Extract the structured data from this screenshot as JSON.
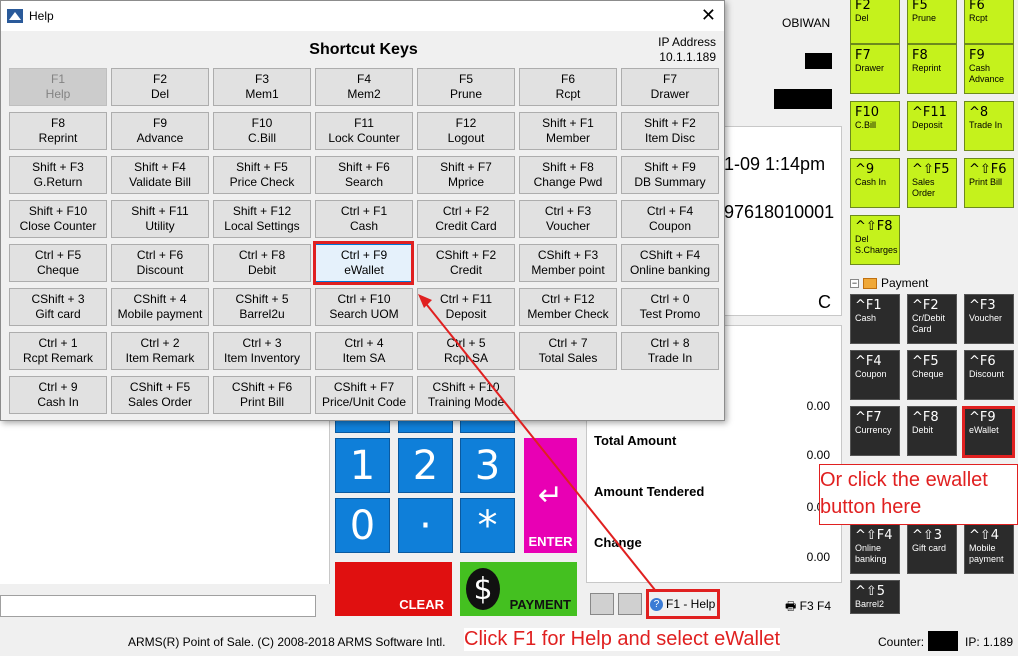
{
  "dialog": {
    "title": "Help",
    "heading": "Shortcut Keys",
    "ip_label": "IP Address",
    "ip_value": "10.1.1.189",
    "keys": [
      {
        "k": "F1",
        "l": "Help"
      },
      {
        "k": "F2",
        "l": "Del"
      },
      {
        "k": "F3",
        "l": "Mem1"
      },
      {
        "k": "F4",
        "l": "Mem2"
      },
      {
        "k": "F5",
        "l": "Prune"
      },
      {
        "k": "F6",
        "l": "Rcpt"
      },
      {
        "k": "F7",
        "l": "Drawer"
      },
      {
        "k": "F8",
        "l": "Reprint"
      },
      {
        "k": "F9",
        "l": "Advance"
      },
      {
        "k": "F10",
        "l": "C.Bill"
      },
      {
        "k": "F11",
        "l": "Lock Counter"
      },
      {
        "k": "F12",
        "l": "Logout"
      },
      {
        "k": "Shift + F1",
        "l": "Member"
      },
      {
        "k": "Shift + F2",
        "l": "Item Disc"
      },
      {
        "k": "Shift + F3",
        "l": "G.Return"
      },
      {
        "k": "Shift + F4",
        "l": "Validate Bill"
      },
      {
        "k": "Shift + F5",
        "l": "Price Check"
      },
      {
        "k": "Shift + F6",
        "l": "Search"
      },
      {
        "k": "Shift + F7",
        "l": "Mprice"
      },
      {
        "k": "Shift + F8",
        "l": "Change Pwd"
      },
      {
        "k": "Shift + F9",
        "l": "DB Summary"
      },
      {
        "k": "Shift + F10",
        "l": "Close Counter"
      },
      {
        "k": "Shift + F11",
        "l": "Utility"
      },
      {
        "k": "Shift + F12",
        "l": "Local Settings"
      },
      {
        "k": "Ctrl + F1",
        "l": "Cash"
      },
      {
        "k": "Ctrl + F2",
        "l": "Credit Card"
      },
      {
        "k": "Ctrl + F3",
        "l": "Voucher"
      },
      {
        "k": "Ctrl + F4",
        "l": "Coupon"
      },
      {
        "k": "Ctrl + F5",
        "l": "Cheque"
      },
      {
        "k": "Ctrl + F6",
        "l": "Discount"
      },
      {
        "k": "Ctrl + F8",
        "l": "Debit"
      },
      {
        "k": "Ctrl + F9",
        "l": "eWallet"
      },
      {
        "k": "CShift + F2",
        "l": "Credit"
      },
      {
        "k": "CShift + F3",
        "l": "Member point"
      },
      {
        "k": "CShift + F4",
        "l": "Online banking"
      },
      {
        "k": "CShift + 3",
        "l": "Gift card"
      },
      {
        "k": "CShift + 4",
        "l": "Mobile payment"
      },
      {
        "k": "CShift + 5",
        "l": "Barrel2u"
      },
      {
        "k": "Ctrl + F10",
        "l": "Search UOM"
      },
      {
        "k": "Ctrl + F11",
        "l": "Deposit"
      },
      {
        "k": "Ctrl + F12",
        "l": "Member Check"
      },
      {
        "k": "Ctrl + 0",
        "l": "Test Promo"
      },
      {
        "k": "Ctrl + 1",
        "l": "Rcpt Remark"
      },
      {
        "k": "Ctrl + 2",
        "l": "Item Remark"
      },
      {
        "k": "Ctrl + 3",
        "l": "Item Inventory"
      },
      {
        "k": "Ctrl + 4",
        "l": "Item SA"
      },
      {
        "k": "Ctrl + 5",
        "l": "Rcpt SA"
      },
      {
        "k": "Ctrl + 7",
        "l": "Total Sales"
      },
      {
        "k": "Ctrl + 8",
        "l": "Trade In"
      },
      {
        "k": "Ctrl + 9",
        "l": "Cash In"
      },
      {
        "k": "CShift + F5",
        "l": "Sales Order"
      },
      {
        "k": "CShift + F6",
        "l": "Print Bill"
      },
      {
        "k": "CShift + F7",
        "l": "Price/Unit Code"
      },
      {
        "k": "CShift + F10",
        "l": "Training Mode"
      }
    ]
  },
  "pos": {
    "user": "OBIWAN",
    "datetime_partial": "1-09 1:14pm",
    "receipt_partial": "97618010001",
    "mode_letter": "C",
    "totals": {
      "row0_value": "0.00",
      "total_amount_label": "Total Amount",
      "total_amount_value": "0.00",
      "amount_tendered_label": "Amount Tendered",
      "amount_tendered_value": "0.00",
      "change_label": "Change",
      "change_value": "0.00"
    },
    "keypad": {
      "k1": "1",
      "k2": "2",
      "k3": "3",
      "k0": "0",
      "kdot": "·",
      "kstar": "*",
      "enter": "ENTER",
      "clear": "CLEAR",
      "payment": "PAYMENT",
      "dollar": "$"
    },
    "help_button": "F1 - Help",
    "f3f4": "F3  F4",
    "payment_group": "Payment",
    "status_left": "ARMS(R) Point of Sale. (C) 2008-2018 ARMS Software Intl.",
    "counter_label": "Counter:",
    "ip_short": "IP: 1.189"
  },
  "function_keys": [
    {
      "k": "F2",
      "l": "Del"
    },
    {
      "k": "F5",
      "l": "Prune"
    },
    {
      "k": "F6",
      "l": "Rcpt"
    },
    {
      "k": "F7",
      "l": "Drawer"
    },
    {
      "k": "F8",
      "l": "Reprint"
    },
    {
      "k": "F9",
      "l": "Cash Advance"
    },
    {
      "k": "F10",
      "l": "C.Bill"
    },
    {
      "k": "^F11",
      "l": "Deposit"
    },
    {
      "k": "^8",
      "l": "Trade In"
    },
    {
      "k": "^9",
      "l": "Cash In"
    },
    {
      "k": "^⇧F5",
      "l": "Sales Order"
    },
    {
      "k": "^⇧F6",
      "l": "Print Bill"
    },
    {
      "k": "^⇧F8",
      "l": "Del S.Charges"
    }
  ],
  "payment_keys": [
    {
      "k": "^F1",
      "l": "Cash"
    },
    {
      "k": "^F2",
      "l": "Cr/Debit Card"
    },
    {
      "k": "^F3",
      "l": "Voucher"
    },
    {
      "k": "^F4",
      "l": "Coupon"
    },
    {
      "k": "^F5",
      "l": "Cheque"
    },
    {
      "k": "^F6",
      "l": "Discount"
    },
    {
      "k": "^F7",
      "l": "Currency"
    },
    {
      "k": "^F8",
      "l": "Debit"
    },
    {
      "k": "^F9",
      "l": "eWallet"
    },
    {
      "k": "^⇧F4",
      "l": "Online banking"
    },
    {
      "k": "^⇧3",
      "l": "Gift card"
    },
    {
      "k": "^⇧4",
      "l": "Mobile payment"
    },
    {
      "k": "^⇧5",
      "l": "Barrel2"
    }
  ],
  "annotations": {
    "callout": "Or click the ewallet button here",
    "bottom": "Click F1 for Help and select eWallet"
  }
}
